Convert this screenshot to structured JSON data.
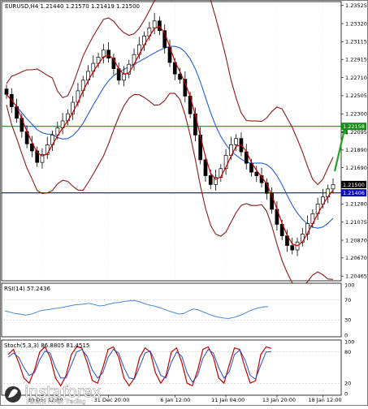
{
  "chart_data": [
    {
      "type": "candlestick",
      "title": "EURUSD,H4  1.21440 1.21570 1.21419 1.21500",
      "ylim": [
        1.2043,
        1.2355
      ],
      "y_ticks": [
        "1.23525",
        "1.23320",
        "1.23115",
        "1.22915",
        "1.22710",
        "1.22505",
        "1.22300",
        "1.22095",
        "1.21890",
        "1.21690",
        "1.21280",
        "1.21075",
        "1.20870",
        "1.20670",
        "1.20465"
      ],
      "x_ticks": [
        "30 Dec 12:00",
        "31 Dec 20:00",
        "6 Jan 12:00",
        "11 Jan 04:00",
        "13 Jan 20:00",
        "18 Jan 12:00"
      ],
      "price_tags": [
        {
          "label": "1.22158",
          "value": 1.22158,
          "color": "#1b8a1b"
        },
        {
          "label": "1.21500",
          "value": 1.215,
          "color": "#000000"
        },
        {
          "label": "1.21406",
          "value": 1.21406,
          "color": "#0b0bb3"
        }
      ],
      "horizontal_lines": [
        {
          "value": 1.22158,
          "color": "#1b8a1b"
        },
        {
          "value": 1.21406,
          "color": "#0b0bb3"
        }
      ],
      "ohlc_close": [
        1.2252,
        1.2238,
        1.2225,
        1.221,
        1.2196,
        1.2188,
        1.2175,
        1.2184,
        1.2195,
        1.2206,
        1.2214,
        1.2222,
        1.223,
        1.2243,
        1.2256,
        1.2268,
        1.2278,
        1.2287,
        1.2294,
        1.2302,
        1.2293,
        1.2281,
        1.2268,
        1.2275,
        1.2286,
        1.2297,
        1.2308,
        1.2318,
        1.2327,
        1.2335,
        1.2324,
        1.2305,
        1.2288,
        1.2275,
        1.2269,
        1.225,
        1.223,
        1.2206,
        1.2178,
        1.216,
        1.215,
        1.2158,
        1.2168,
        1.2183,
        1.2195,
        1.2202,
        1.2187,
        1.2174,
        1.2164,
        1.216,
        1.2152,
        1.214,
        1.2122,
        1.2105,
        1.2092,
        1.2081,
        1.2076,
        1.2085,
        1.2094,
        1.2106,
        1.2117,
        1.2128,
        1.2136,
        1.2145,
        1.215
      ],
      "series": [
        {
          "name": "",
          "color": "#c00000"
        },
        {
          "name": "",
          "color": "#1f5fd0"
        },
        {
          "name": "",
          "color": "#8b1a1a"
        }
      ]
    },
    {
      "type": "line",
      "title": "RSI(14) 57.2436",
      "ylim": [
        0,
        100
      ],
      "y_ticks": [
        "100",
        "70",
        "30",
        "0"
      ],
      "values": [
        48,
        46,
        43,
        42,
        40,
        41,
        44,
        48,
        50,
        51,
        53,
        54,
        56,
        58,
        60,
        61,
        62,
        63,
        61,
        58,
        59,
        62,
        64,
        65,
        67,
        68,
        69,
        67,
        63,
        60,
        58,
        55,
        52,
        48,
        45,
        42,
        43,
        48,
        52,
        50,
        46,
        42,
        38,
        36,
        34,
        33,
        35,
        38,
        42,
        47,
        51,
        54,
        56,
        57
      ]
    },
    {
      "type": "line",
      "title": "Stoch(5,3,3) 86.8805 81.4515",
      "ylim": [
        0,
        100
      ],
      "y_ticks": [
        "100",
        "80",
        "20",
        "0"
      ],
      "series": [
        {
          "name": "",
          "color": "#c00000",
          "values": [
            75,
            85,
            60,
            30,
            20,
            45,
            80,
            90,
            70,
            30,
            15,
            35,
            75,
            90,
            88,
            60,
            25,
            20,
            50,
            85,
            90,
            70,
            30,
            15,
            30,
            70,
            88,
            80,
            40,
            20,
            35,
            80,
            88,
            60,
            20,
            15,
            45,
            85,
            90,
            70,
            30,
            20,
            55,
            88,
            85,
            50,
            20,
            25,
            75,
            90,
            87
          ]
        },
        {
          "name": "",
          "color": "#2a4fc0",
          "values": [
            70,
            78,
            70,
            50,
            35,
            40,
            65,
            82,
            78,
            50,
            30,
            30,
            55,
            80,
            85,
            72,
            45,
            30,
            40,
            70,
            85,
            78,
            50,
            30,
            28,
            52,
            78,
            82,
            60,
            35,
            30,
            60,
            80,
            72,
            40,
            22,
            35,
            68,
            85,
            78,
            50,
            30,
            42,
            75,
            84,
            65,
            35,
            28,
            55,
            80,
            81
          ]
        }
      ]
    }
  ],
  "watermark": {
    "brand": "instaforex",
    "tagline": "Instant Forex Trading"
  }
}
